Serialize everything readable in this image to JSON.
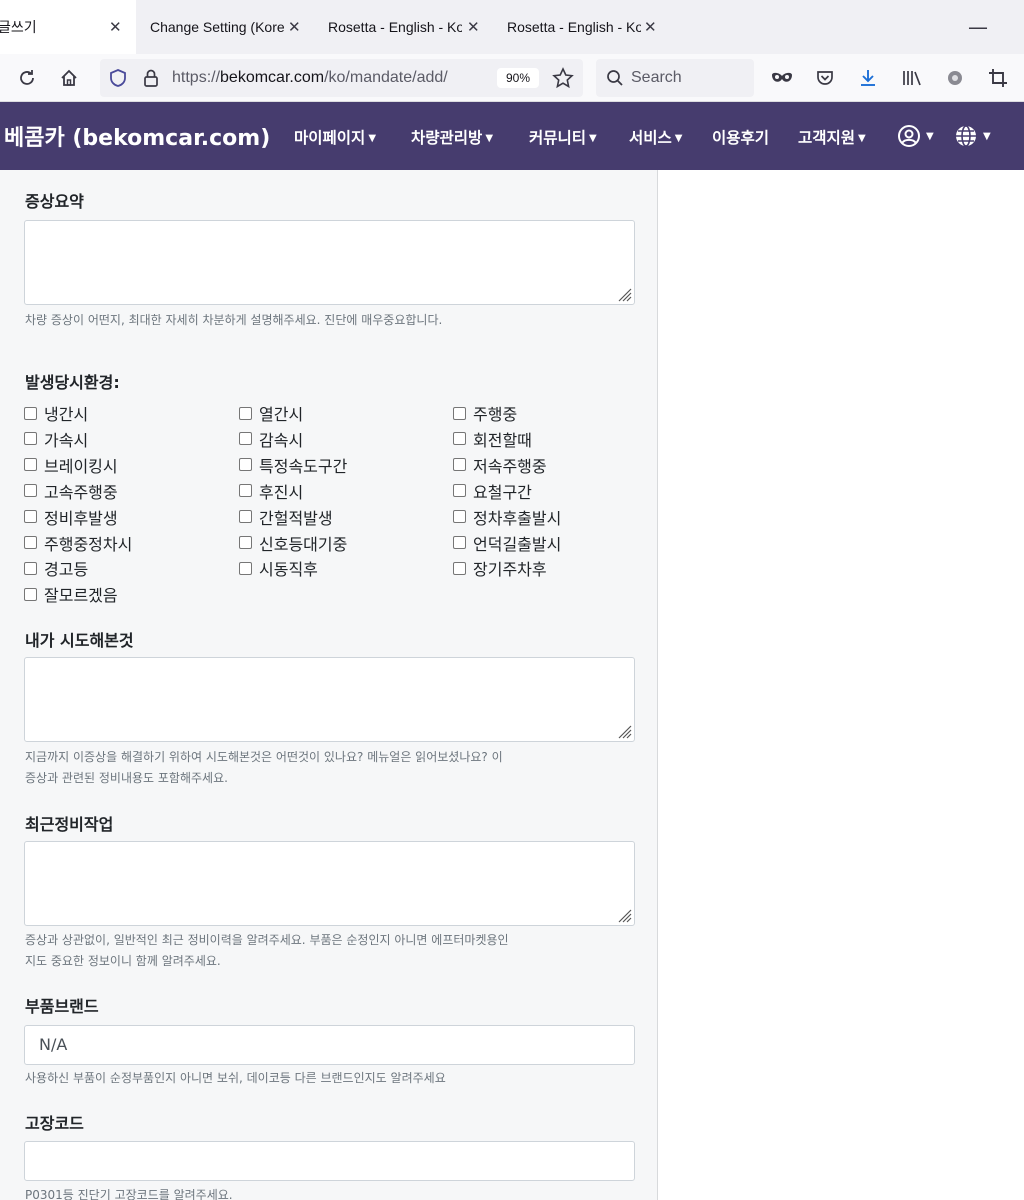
{
  "browser": {
    "tabs": [
      {
        "title": "글쓰기",
        "active": true
      },
      {
        "title": "Change Setting (Kore",
        "active": false
      },
      {
        "title": "Rosetta - English - Ko",
        "active": false
      },
      {
        "title": "Rosetta - English - Ko",
        "active": false
      }
    ],
    "close_glyph": "✕",
    "minimize_glyph": "—",
    "url_prefix": "https://",
    "url_host": "bekomcar.com",
    "url_path": "/ko/mandate/add/",
    "zoom": "90%",
    "search_placeholder": "Search"
  },
  "site": {
    "brand": "베콤카 (bekomcar.com)",
    "menu": [
      {
        "label": "마이페이지",
        "dropdown": true
      },
      {
        "label": "차량관리방",
        "dropdown": true
      },
      {
        "label": "커뮤니티",
        "dropdown": true
      },
      {
        "label": "서비스",
        "dropdown": true
      },
      {
        "label": "이용후기",
        "dropdown": false
      },
      {
        "label": "고객지원",
        "dropdown": true
      }
    ],
    "caret": "▼"
  },
  "form": {
    "symptom_summary": {
      "label": "증상요약",
      "value": "",
      "help": "차량 증상이 어떤지, 최대한 자세히 차분하게 설명해주세요. 진단에 매우중요합니다."
    },
    "environment": {
      "label": "발생당시환경:",
      "options": [
        "냉간시",
        "열간시",
        "주행중",
        "가속시",
        "감속시",
        "회전할때",
        "브레이킹시",
        "특정속도구간",
        "저속주행중",
        "고속주행중",
        "후진시",
        "요철구간",
        "정비후발생",
        "간헐적발생",
        "정차후출발시",
        "주행중정차시",
        "신호등대기중",
        "언덕길출발시",
        "경고등",
        "시동직후",
        "장기주차후",
        "잘모르겠음"
      ]
    },
    "attempts": {
      "label": "내가 시도해본것",
      "value": "",
      "help_line1": "지금까지 이증상을 해결하기 위하여 시도해본것은 어떤것이 있나요? 메뉴얼은 읽어보셨나요? 이",
      "help_line2": "증상과 관련된 정비내용도 포함해주세요."
    },
    "recent_maintenance": {
      "label": "최근정비작업",
      "value": "",
      "help_line1": "증상과 상관없이, 일반적인 최근 정비이력을 알려주세요. 부품은 순정인지 아니면 에프터마켓용인",
      "help_line2": "지도 중요한 정보이니 함께 알려주세요."
    },
    "parts_brand": {
      "label": "부품브랜드",
      "value": "N/A",
      "help": "사용하신 부품이 순정부품인지 아니면 보쉬, 데이코등 다른 브랜드인지도 알려주세요"
    },
    "fault_code": {
      "label": "고장코드",
      "value": "",
      "help": "P0301등 진단기 고장코드를 알려주세요."
    }
  }
}
